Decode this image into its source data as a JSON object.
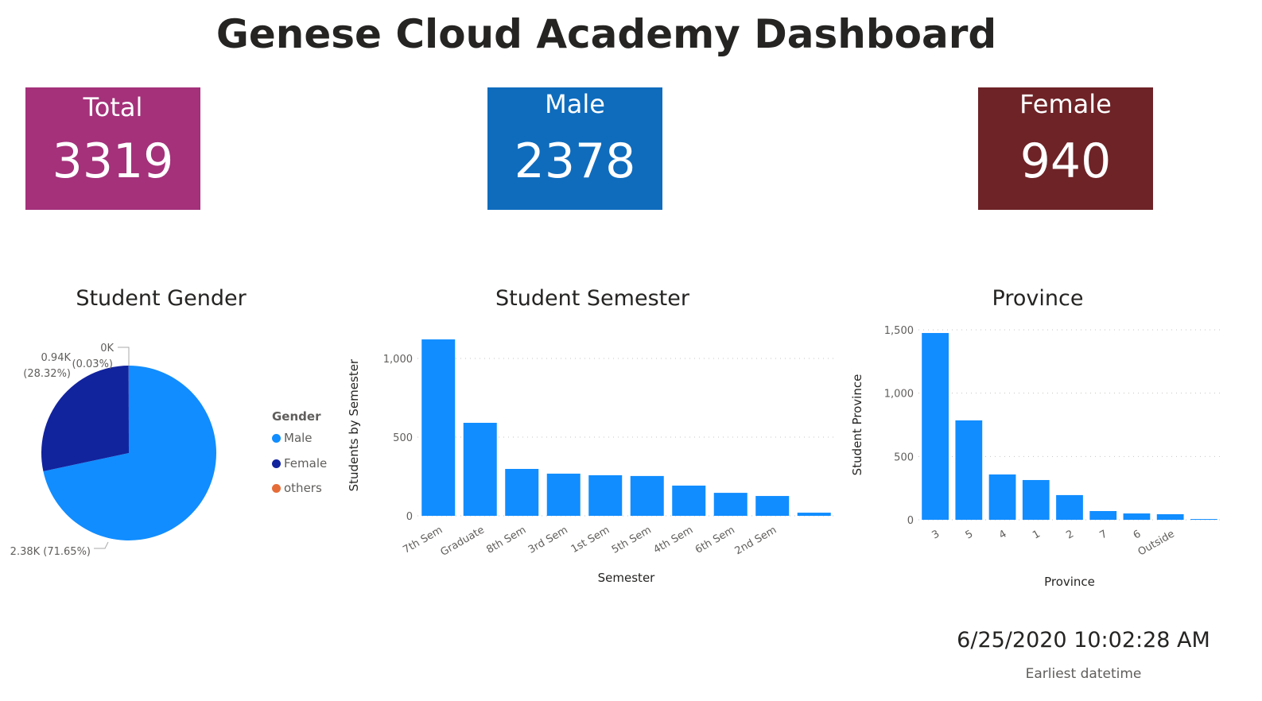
{
  "title": "Genese Cloud Academy Dashboard",
  "cards": [
    {
      "label": "Total",
      "value": "3319",
      "color": "#a4317a"
    },
    {
      "label": "Male",
      "value": "2378",
      "color": "#0f6cbd"
    },
    {
      "label": "Female",
      "value": "940",
      "color": "#6e2327"
    }
  ],
  "datetime": {
    "value": "6/25/2020 10:02:28 AM",
    "label": "Earliest datetime"
  },
  "chart_data": [
    {
      "type": "pie",
      "title": "Student Gender",
      "legend_title": "Gender",
      "legend_position": "right",
      "slices": [
        {
          "name": "Male",
          "value": 2378,
          "pct": 71.65,
          "label": "2.38K (71.65%)",
          "color": "#118dff"
        },
        {
          "name": "Female",
          "value": 940,
          "pct": 28.32,
          "label_value": "0.94K",
          "label_pct": "(28.32%)",
          "color": "#12239e"
        },
        {
          "name": "others",
          "value": 1,
          "pct": 0.03,
          "label_value": "0K",
          "label_pct": "(0.03%)",
          "color": "#e66c37"
        }
      ]
    },
    {
      "type": "bar",
      "title": "Student Semester",
      "xlabel": "Semester",
      "ylabel": "Students by Semester",
      "ylim": [
        0,
        1150
      ],
      "yticks": [
        0,
        500,
        1000
      ],
      "ytick_labels": [
        "0",
        "500",
        "1,000"
      ],
      "grid": true,
      "categories": [
        "7th Sem",
        "Graduate",
        "8th Sem",
        "3rd Sem",
        "1st Sem",
        "5th Sem",
        "4th Sem",
        "6th Sem",
        "2nd Sem",
        ""
      ],
      "values": [
        1121,
        591,
        298,
        268,
        258,
        253,
        192,
        146,
        126,
        20
      ]
    },
    {
      "type": "bar",
      "title": "Province",
      "xlabel": "Province",
      "ylabel": "Student Province",
      "ylim": [
        0,
        1500
      ],
      "yticks": [
        0,
        500,
        1000,
        1500
      ],
      "ytick_labels": [
        "0",
        "500",
        "1,000",
        "1,500"
      ],
      "grid": true,
      "categories": [
        "3",
        "5",
        "4",
        "1",
        "2",
        "7",
        "6",
        "Outside",
        ""
      ],
      "values": [
        1475,
        785,
        358,
        314,
        195,
        69,
        50,
        44,
        6
      ]
    }
  ]
}
